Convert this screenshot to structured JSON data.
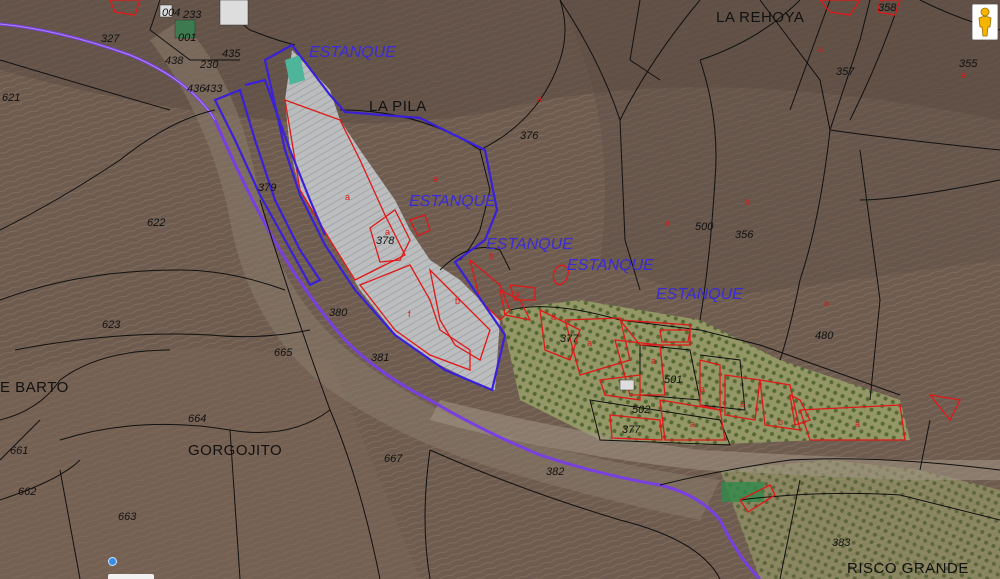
{
  "map": {
    "place_names": [
      {
        "text": "LA REHOYA"
      },
      {
        "text": "LA PILA"
      },
      {
        "text": "E BARTO"
      },
      {
        "text": "GORGOJITO"
      },
      {
        "text": "RISCO GRANDE"
      }
    ],
    "pond_labels": [
      {
        "text": "ESTANQUE"
      },
      {
        "text": "ESTANQUE"
      },
      {
        "text": "ESTANQUE"
      },
      {
        "text": "ESTANQUE"
      },
      {
        "text": "ESTANQUE"
      }
    ],
    "parcel_numbers": [
      "327",
      "233",
      "004",
      "001",
      "438",
      "435",
      "436",
      "230",
      "433",
      "621",
      "379",
      "622",
      "623",
      "665",
      "664",
      "380",
      "381",
      "378",
      "376",
      "377",
      "501",
      "502",
      "377",
      "500",
      "356",
      "357",
      "355",
      "358",
      "480",
      "382",
      "667",
      "661",
      "662",
      "663",
      "383"
    ],
    "subparcel_letters": [
      "a",
      "a",
      "a",
      "b",
      "a",
      "a",
      "f",
      "b",
      "a",
      "b",
      "a",
      "a",
      "a",
      "a",
      "a",
      "a",
      "a",
      "b",
      "a",
      "a",
      "a"
    ],
    "colors": {
      "cadastral_line": "#111111",
      "subparcel_line": "#e01818",
      "highlight_boundary": "#3a20d8",
      "road": "#7a3fe0"
    },
    "icons": [
      "pegman-icon",
      "location-dot-icon"
    ]
  }
}
